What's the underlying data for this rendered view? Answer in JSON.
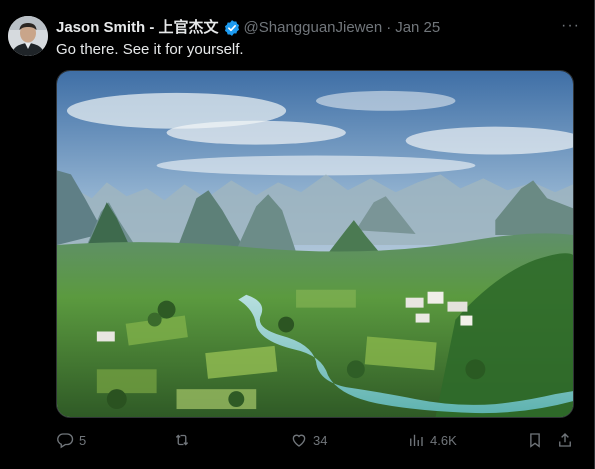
{
  "tweet": {
    "display_name": "Jason Smith - 上官杰文",
    "handle": "@ShangguanJiewen",
    "separator": "·",
    "date": "Jan 25",
    "text": "Go there. See it for yourself.",
    "more_label": "···"
  },
  "icons": {
    "verified": "verified-badge-icon",
    "more": "more-options-icon",
    "reply": "reply-icon",
    "retweet": "retweet-icon",
    "like": "heart-icon",
    "views": "views-icon",
    "bookmark": "bookmark-icon",
    "share": "share-icon"
  },
  "actions": {
    "replies": "5",
    "retweets": "",
    "likes": "34",
    "views": "4.6K"
  },
  "colors": {
    "background": "#000000",
    "text": "#e7e9ea",
    "muted": "#71767b",
    "verified": "#1d9bf0"
  }
}
